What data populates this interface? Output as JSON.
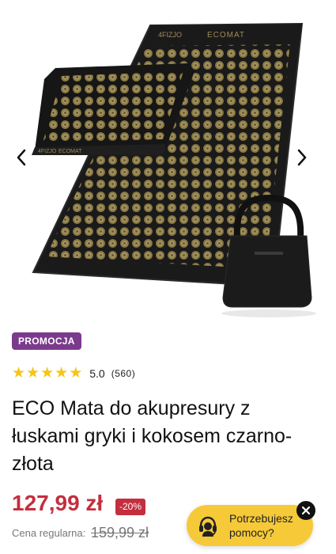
{
  "product_gallery": {
    "image_alt": "ECO Mata do akupresury z łuskami gryki i kokosem czarno-złota",
    "mat_brand_text": "ECOMAT",
    "mat_logo_text": "4FIZJO",
    "prev_icon": "chevron-left-icon",
    "next_icon": "chevron-right-icon"
  },
  "badge": {
    "label": "PROMOCJA",
    "color": "#7b3a8c"
  },
  "rating": {
    "stars": 5,
    "value": "5.0",
    "count": "(560)",
    "star_color": "#f5c518"
  },
  "product": {
    "title": "ECO Mata do akupresury z łuskami gryki i kokosem czarno-złota"
  },
  "pricing": {
    "price": "127,99 zł",
    "discount": "-20%",
    "regular_label": "Cena regularna:",
    "regular_price": "159,99 zł",
    "price_color": "#c32f3e"
  },
  "help_widget": {
    "text": "Potrzebujesz pomocy?",
    "icon": "headset-icon",
    "close_icon": "close-icon",
    "bg_color": "#f6c938"
  }
}
